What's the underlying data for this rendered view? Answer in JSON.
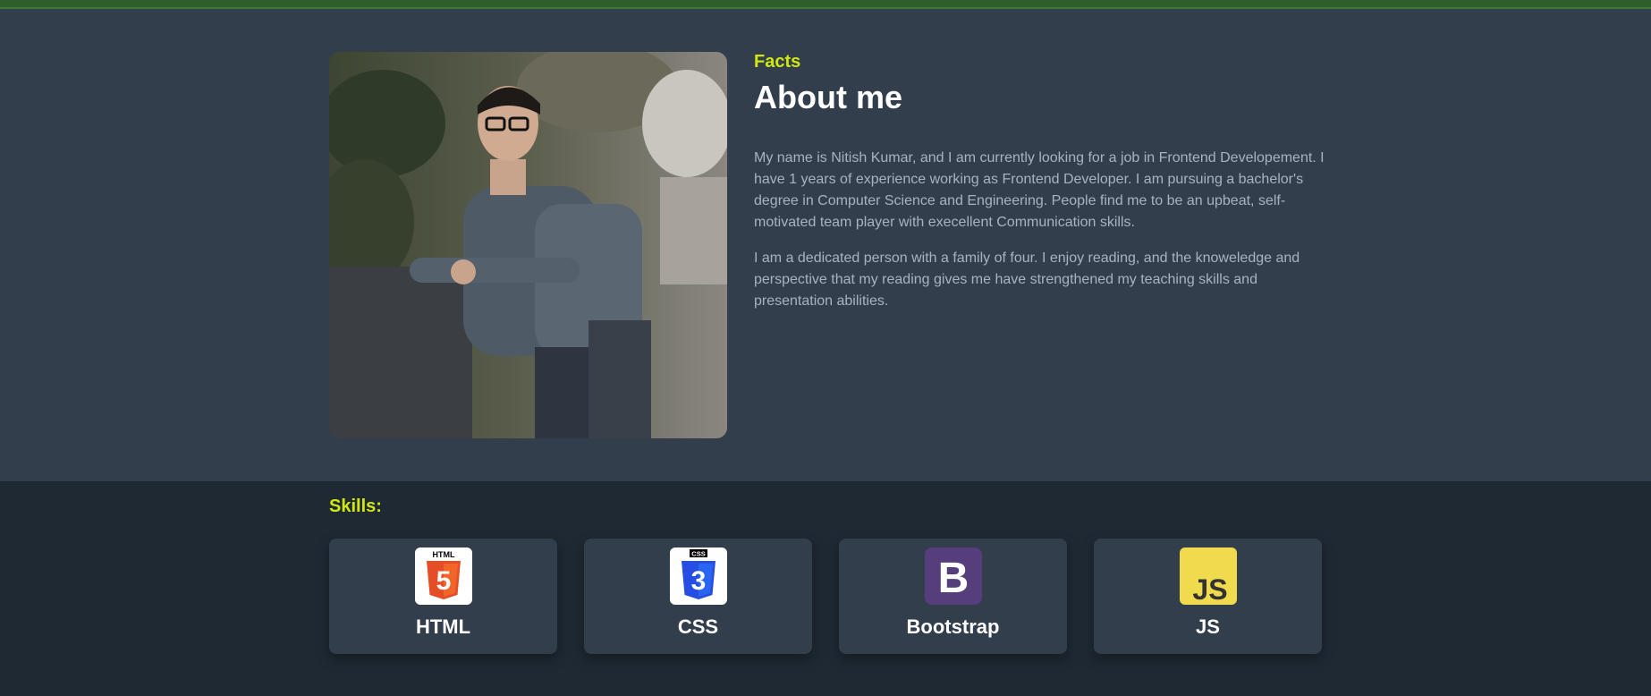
{
  "about": {
    "label": "Facts",
    "title": "About me",
    "paragraphs": [
      "My name is Nitish Kumar, and I am currently looking for a job in Frontend Developement. I have 1 years of experience working as Frontend Developer. I am pursuing a bachelor's degree in Computer Science and Engineering. People find me to be an upbeat, self-motivated team player with execellent Communication skills.",
      "I am a dedicated person with a family of four. I enjoy reading, and the knoweledge and perspective that my reading gives me have strengthened my teaching skills and presentation abilities."
    ]
  },
  "skills": {
    "title": "Skills:",
    "items": [
      {
        "name": "HTML",
        "icon": "html5-icon",
        "badge_text": "HTML",
        "glyph": "5"
      },
      {
        "name": "CSS",
        "icon": "css3-icon",
        "badge_text": "CSS",
        "glyph": "3"
      },
      {
        "name": "Bootstrap",
        "icon": "bootstrap-icon",
        "glyph": "B"
      },
      {
        "name": "JS",
        "icon": "javascript-icon",
        "glyph": "JS"
      }
    ]
  },
  "colors": {
    "accent": "#cfe80f",
    "about_bg": "#323e4b",
    "skills_bg": "#1f2933",
    "card_bg": "#323e4b",
    "top_bar": "#2e5e2b",
    "html_orange": "#e44d26",
    "css_blue": "#264de4",
    "bootstrap_purple": "#563d7c",
    "js_yellow": "#f0db4f"
  }
}
